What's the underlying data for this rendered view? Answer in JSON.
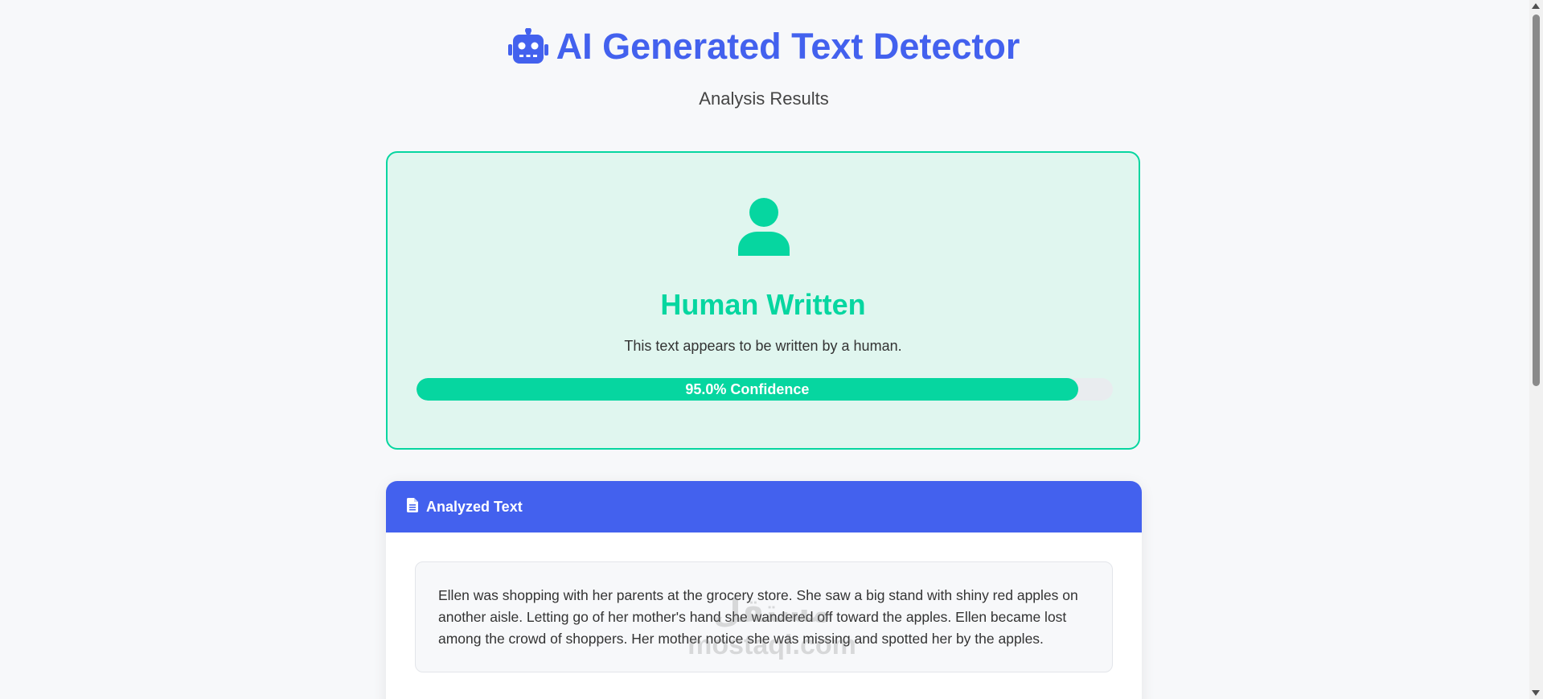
{
  "header": {
    "title": "AI Generated Text Detector",
    "subtitle": "Analysis Results",
    "icon": "robot-icon"
  },
  "result": {
    "label": "Human Written",
    "description": "This text appears to be written by a human.",
    "confidence_text": "95.0% Confidence",
    "confidence_fraction": 0.95,
    "icon": "user-icon",
    "accent_color": "#06d6a0"
  },
  "analyzed": {
    "header_label": "Analyzed Text",
    "icon": "file-icon",
    "body": "Ellen was shopping with her parents at the grocery store. She saw a big stand with shiny red apples on another aisle. Letting go of her mother's hand she wandered off toward the apples. Ellen became lost among the crowd of shoppers. Her mother notice she was missing and spotted her by the apples."
  },
  "watermark": {
    "arabic": "مستقل",
    "latin": "mostaql.com"
  },
  "colors": {
    "primary": "#4361ee",
    "success": "#06d6a0"
  }
}
